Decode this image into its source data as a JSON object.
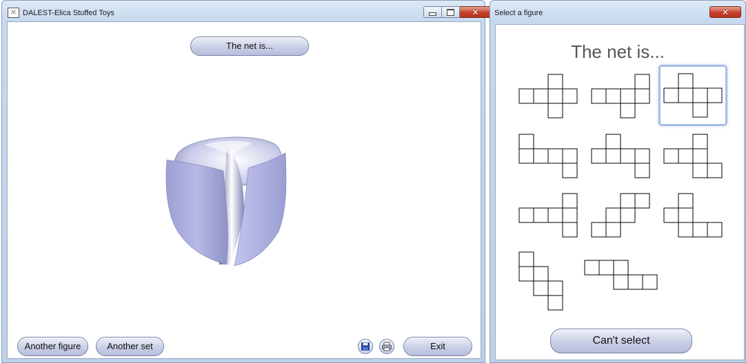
{
  "main_window": {
    "title": "DALEST-Elica Stuffed Toys",
    "app_icon_text": "ℳ",
    "net_button_label": "The net is...",
    "buttons": {
      "another_figure": "Another figure",
      "another_set": "Another set",
      "exit": "Exit"
    },
    "icons": [
      "save-icon",
      "print-icon"
    ]
  },
  "select_window": {
    "title": "Select a figure",
    "heading": "The net is...",
    "cant_select_label": "Can't select",
    "selected_index": 2,
    "nets": [
      [
        [
          0,
          1
        ],
        [
          1,
          1
        ],
        [
          2,
          1
        ],
        [
          3,
          1
        ],
        [
          2,
          0
        ],
        [
          2,
          2
        ]
      ],
      [
        [
          0,
          1
        ],
        [
          1,
          1
        ],
        [
          2,
          1
        ],
        [
          3,
          1
        ],
        [
          3,
          0
        ],
        [
          2,
          2
        ]
      ],
      [
        [
          0,
          1
        ],
        [
          1,
          1
        ],
        [
          2,
          1
        ],
        [
          3,
          1
        ],
        [
          1,
          0
        ],
        [
          2,
          2
        ]
      ],
      [
        [
          0,
          0
        ],
        [
          0,
          1
        ],
        [
          1,
          1
        ],
        [
          2,
          1
        ],
        [
          3,
          1
        ],
        [
          3,
          2
        ]
      ],
      [
        [
          0,
          1
        ],
        [
          1,
          1
        ],
        [
          2,
          1
        ],
        [
          3,
          1
        ],
        [
          1,
          0
        ],
        [
          3,
          2
        ]
      ],
      [
        [
          0,
          1
        ],
        [
          1,
          1
        ],
        [
          2,
          1
        ],
        [
          2,
          0
        ],
        [
          2,
          2
        ],
        [
          3,
          2
        ]
      ],
      [
        [
          0,
          1
        ],
        [
          1,
          1
        ],
        [
          2,
          1
        ],
        [
          3,
          0
        ],
        [
          3,
          1
        ],
        [
          3,
          2
        ]
      ],
      [
        [
          0,
          2
        ],
        [
          1,
          2
        ],
        [
          1,
          1
        ],
        [
          2,
          1
        ],
        [
          2,
          0
        ],
        [
          3,
          0
        ]
      ],
      [
        [
          0,
          1
        ],
        [
          1,
          1
        ],
        [
          1,
          0
        ],
        [
          1,
          2
        ],
        [
          2,
          2
        ],
        [
          3,
          2
        ]
      ],
      [
        [
          0,
          0
        ],
        [
          0,
          1
        ],
        [
          1,
          1
        ],
        [
          1,
          2
        ],
        [
          2,
          2
        ],
        [
          2,
          3
        ]
      ],
      [
        [
          0,
          0
        ],
        [
          1,
          0
        ],
        [
          2,
          0
        ],
        [
          2,
          1
        ],
        [
          3,
          1
        ],
        [
          4,
          1
        ]
      ]
    ]
  },
  "colors": {
    "window_frame": "#c7d9ee",
    "figure_fill": "#b5b8e2",
    "selection_glow": "#a8bde8",
    "close_button": "#c7412a"
  }
}
